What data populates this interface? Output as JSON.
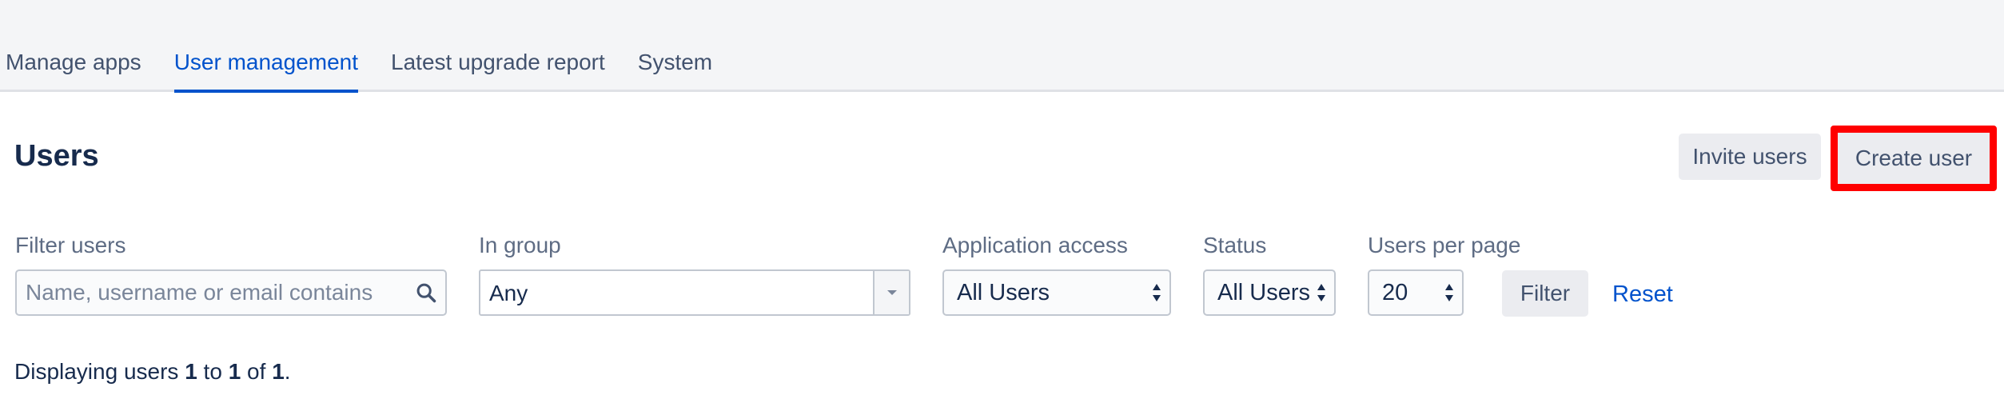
{
  "tabs": [
    {
      "label": "Manage apps",
      "active": false
    },
    {
      "label": "User management",
      "active": true
    },
    {
      "label": "Latest upgrade report",
      "active": false
    },
    {
      "label": "System",
      "active": false
    }
  ],
  "page": {
    "title": "Users"
  },
  "actions": {
    "invite_label": "Invite users",
    "create_label": "Create user",
    "highlight_color": "#ff0000"
  },
  "filters": {
    "filter_users_label": "Filter users",
    "filter_users_placeholder": "Name, username or email contains",
    "in_group_label": "In group",
    "in_group_value": "Any",
    "app_access_label": "Application access",
    "app_access_value": "All Users",
    "status_label": "Status",
    "status_value": "All Users",
    "per_page_label": "Users per page",
    "per_page_value": "20",
    "filter_button": "Filter",
    "reset_link": "Reset"
  },
  "results": {
    "prefix": "Displaying users ",
    "from": "1",
    "to_word": " to ",
    "to": "1",
    "of_word": " of ",
    "total": "1",
    "suffix": "."
  },
  "colors": {
    "accent": "#0052cc",
    "text": "#172b4d",
    "muted": "#42526e"
  },
  "icons": {
    "search": "search-icon",
    "dropdown": "chevron-down-icon",
    "select_arrows": "select-arrows-icon"
  }
}
